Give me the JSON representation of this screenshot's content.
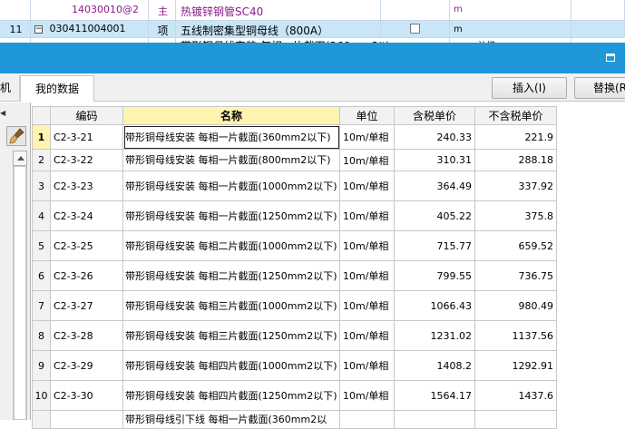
{
  "background_rows": [
    {
      "num": "",
      "code": "14030010@2",
      "type": "主",
      "name": "热镀锌钢管SC40",
      "unit": "m",
      "selected": false
    },
    {
      "num": "11",
      "code": "030411004001",
      "type": "项",
      "name": "五线制密集型铜母线（800A）",
      "unit": "m",
      "selected": true
    },
    {
      "num": "",
      "code": "",
      "type": "",
      "name": "带形铜母线安装 每相一片截面(360mm2以",
      "unit": "10m/单相",
      "selected": false
    }
  ],
  "dialog": {
    "tabs": {
      "machine_partial": "机",
      "my_data": "我的数据"
    },
    "buttons": {
      "insert": "插入(I)",
      "replace": "替换(R"
    }
  },
  "table": {
    "headers": {
      "code": "编码",
      "name": "名称",
      "unit": "单位",
      "tax_price": "含税单价",
      "notax_price": "不含税单价"
    },
    "rows": [
      {
        "num": "1",
        "code": "C2-3-21",
        "name": "带形铜母线安装 每相一片截面(360mm2以下)",
        "unit": "10m/单相",
        "tax_price": "240.33",
        "notax_price": "221.9",
        "active": true
      },
      {
        "num": "2",
        "code": "C2-3-22",
        "name": "带形铜母线安装 每相一片截面(800mm2以下)",
        "unit": "10m/单相",
        "tax_price": "310.31",
        "notax_price": "288.18"
      },
      {
        "num": "3",
        "code": "C2-3-23",
        "name": "带形铜母线安装 每相一片截面(1000mm2以下)",
        "unit": "10m/单相",
        "tax_price": "364.49",
        "notax_price": "337.92"
      },
      {
        "num": "4",
        "code": "C2-3-24",
        "name": "带形铜母线安装 每相一片截面(1250mm2以下)",
        "unit": "10m/单相",
        "tax_price": "405.22",
        "notax_price": "375.8"
      },
      {
        "num": "5",
        "code": "C2-3-25",
        "name": "带形铜母线安装 每相二片截面(1000mm2以下)",
        "unit": "10m/单相",
        "tax_price": "715.77",
        "notax_price": "659.52"
      },
      {
        "num": "6",
        "code": "C2-3-26",
        "name": "带形铜母线安装 每相二片截面(1250mm2以下)",
        "unit": "10m/单相",
        "tax_price": "799.55",
        "notax_price": "736.75"
      },
      {
        "num": "7",
        "code": "C2-3-27",
        "name": "带形铜母线安装 每相三片截面(1000mm2以下)",
        "unit": "10m/单相",
        "tax_price": "1066.43",
        "notax_price": "980.49"
      },
      {
        "num": "8",
        "code": "C2-3-28",
        "name": "带形铜母线安装 每相三片截面(1250mm2以下)",
        "unit": "10m/单相",
        "tax_price": "1231.02",
        "notax_price": "1137.56"
      },
      {
        "num": "9",
        "code": "C2-3-29",
        "name": "带形铜母线安装 每相四片截面(1000mm2以下)",
        "unit": "10m/单相",
        "tax_price": "1408.2",
        "notax_price": "1292.91"
      },
      {
        "num": "10",
        "code": "C2-3-30",
        "name": "带形铜母线安装 每相四片截面(1250mm2以下)",
        "unit": "10m/单相",
        "tax_price": "1564.17",
        "notax_price": "1437.6"
      },
      {
        "num": "",
        "code": "",
        "name": "带形铜母线引下线 每相一片截面(360mm2以",
        "unit": "",
        "tax_price": "",
        "notax_price": ""
      }
    ]
  },
  "colors": {
    "title_bar": "#1e98d8",
    "active_header": "#fff3b0",
    "selected_row": "#c8e6f8",
    "material_text": "#8b1a8b"
  },
  "icons": [
    "brush-icon",
    "maximize-icon",
    "collapse-arrow-icon",
    "scroll-up-icon",
    "checkbox-icon"
  ]
}
